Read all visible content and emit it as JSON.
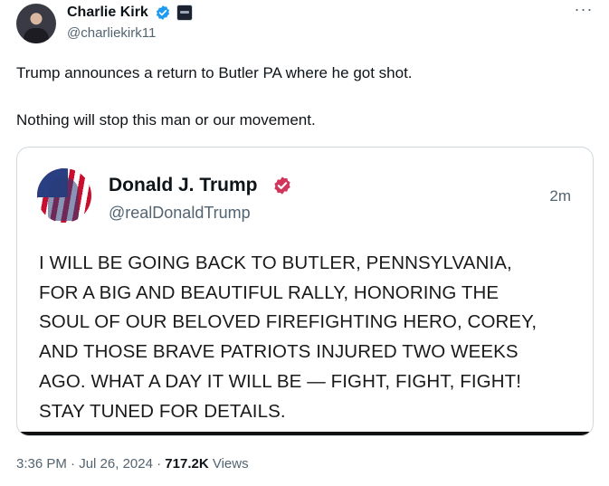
{
  "tweet": {
    "author": {
      "name": "Charlie Kirk",
      "handle": "@charliekirk11",
      "verified": true
    },
    "text": [
      "Trump announces a return to Butler PA where he got shot.",
      "Nothing will stop this man or our movement."
    ],
    "more_label": "···",
    "quoted": {
      "author_name": "Donald J. Trump",
      "author_handle": "@realDonaldTrump",
      "time_ago": "2m",
      "lines": [
        "I WILL BE GOING BACK TO BUTLER, PENNSYLVANIA,",
        "FOR A BIG AND BEAUTIFUL RALLY, HONORING THE",
        "SOUL OF OUR BELOVED FIREFIGHTING HERO, COREY,",
        "AND THOSE BRAVE PATRIOTS INJURED TWO WEEKS",
        "AGO. WHAT A DAY IT WILL BE — FIGHT, FIGHT, FIGHT!",
        "STAY TUNED FOR DETAILS."
      ]
    },
    "meta": {
      "time": "3:36 PM",
      "separator": "·",
      "date": "Jul 26, 2024",
      "views_count": "717.2K",
      "views_label": "Views"
    }
  },
  "colors": {
    "verified_blue": "#1d9bf0",
    "truth_badge": "#d1355c",
    "secondary_text": "#536471"
  }
}
